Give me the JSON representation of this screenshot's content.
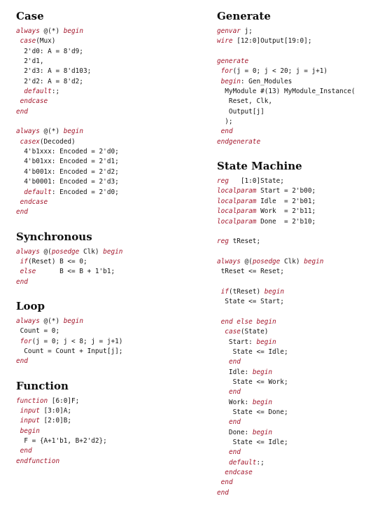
{
  "left_column": [
    {
      "title": "Case",
      "gap_before": 0,
      "lines": [
        [
          {
            "t": "always",
            "k": 1
          },
          {
            "t": " @(*) "
          },
          {
            "t": "begin",
            "k": 1
          }
        ],
        [
          {
            "t": " "
          },
          {
            "t": "case",
            "k": 1
          },
          {
            "t": "(Mux)"
          }
        ],
        [
          {
            "t": "  2'd0: A = 8'd9;"
          }
        ],
        [
          {
            "t": "  2'd1,"
          }
        ],
        [
          {
            "t": "  2'd3: A = 8'd103;"
          }
        ],
        [
          {
            "t": "  2'd2: A = 8'd2;"
          }
        ],
        [
          {
            "t": "  "
          },
          {
            "t": "default",
            "k": 1
          },
          {
            "t": ":;"
          }
        ],
        [
          {
            "t": " "
          },
          {
            "t": "endcase",
            "k": 1
          }
        ],
        [
          {
            "t": "end",
            "k": 1
          }
        ],
        [],
        [
          {
            "t": "always",
            "k": 1
          },
          {
            "t": " @(*) "
          },
          {
            "t": "begin",
            "k": 1
          }
        ],
        [
          {
            "t": " "
          },
          {
            "t": "casex",
            "k": 1
          },
          {
            "t": "(Decoded)"
          }
        ],
        [
          {
            "t": "  4'b1xxx: Encoded = 2'd0;"
          }
        ],
        [
          {
            "t": "  4'b01xx: Encoded = 2'd1;"
          }
        ],
        [
          {
            "t": "  4'b001x: Encoded = 2'd2;"
          }
        ],
        [
          {
            "t": "  4'b0001: Encoded = 2'd3;"
          }
        ],
        [
          {
            "t": "  "
          },
          {
            "t": "default",
            "k": 1
          },
          {
            "t": ": Encoded = 2'd0;"
          }
        ],
        [
          {
            "t": " "
          },
          {
            "t": "endcase",
            "k": 1
          }
        ],
        [
          {
            "t": "end",
            "k": 1
          }
        ]
      ]
    },
    {
      "title": "Synchronous",
      "gap_before": 2,
      "lines": [
        [
          {
            "t": "always",
            "k": 1
          },
          {
            "t": " @("
          },
          {
            "t": "posedge",
            "k": 1
          },
          {
            "t": " Clk) "
          },
          {
            "t": "begin",
            "k": 1
          }
        ],
        [
          {
            "t": " "
          },
          {
            "t": "if",
            "k": 1
          },
          {
            "t": "(Reset) B <= 0;"
          }
        ],
        [
          {
            "t": " "
          },
          {
            "t": "else",
            "k": 1
          },
          {
            "t": "      B <= B + 1'b1;"
          }
        ],
        [
          {
            "t": "end",
            "k": 1
          }
        ]
      ]
    },
    {
      "title": "Loop",
      "gap_before": 2,
      "lines": [
        [
          {
            "t": "always",
            "k": 1
          },
          {
            "t": " @(*) "
          },
          {
            "t": "begin",
            "k": 1
          }
        ],
        [
          {
            "t": " Count = 0;"
          }
        ],
        [
          {
            "t": " "
          },
          {
            "t": "for",
            "k": 1
          },
          {
            "t": "(j = 0; j < 8; j = j+1)"
          }
        ],
        [
          {
            "t": "  Count = Count + Input[j];"
          }
        ],
        [
          {
            "t": "end",
            "k": 1
          }
        ]
      ]
    },
    {
      "title": "Function",
      "gap_before": 2,
      "lines": [
        [
          {
            "t": "function",
            "k": 1
          },
          {
            "t": " [6:0]F;"
          }
        ],
        [
          {
            "t": " "
          },
          {
            "t": "input",
            "k": 1
          },
          {
            "t": " [3:0]A;"
          }
        ],
        [
          {
            "t": " "
          },
          {
            "t": "input",
            "k": 1
          },
          {
            "t": " [2:0]B;"
          }
        ],
        [
          {
            "t": " "
          },
          {
            "t": "begin",
            "k": 1
          }
        ],
        [
          {
            "t": "  F = {A+1'b1, B+2'd2};"
          }
        ],
        [
          {
            "t": " "
          },
          {
            "t": "end",
            "k": 1
          }
        ],
        [
          {
            "t": "endfunction",
            "k": 1
          }
        ]
      ]
    }
  ],
  "right_column": [
    {
      "title": "Generate",
      "gap_before": 0,
      "lines": [
        [
          {
            "t": "genvar",
            "k": 1
          },
          {
            "t": " j;"
          }
        ],
        [
          {
            "t": "wire",
            "k": 1
          },
          {
            "t": " [12:0]Output[19:0];"
          }
        ],
        [],
        [
          {
            "t": "generate",
            "k": 1
          }
        ],
        [
          {
            "t": " "
          },
          {
            "t": "for",
            "k": 1
          },
          {
            "t": "(j = 0; j < 20; j = j+1)"
          }
        ],
        [
          {
            "t": " "
          },
          {
            "t": "begin",
            "k": 1
          },
          {
            "t": ": Gen_Modules"
          }
        ],
        [
          {
            "t": "  MyModule #(13) MyModule_Instance("
          }
        ],
        [
          {
            "t": "   Reset, Clk,"
          }
        ],
        [
          {
            "t": "   Output[j]"
          }
        ],
        [
          {
            "t": "  );"
          }
        ],
        [
          {
            "t": " "
          },
          {
            "t": "end",
            "k": 1
          }
        ],
        [
          {
            "t": "endgenerate",
            "k": 1
          }
        ]
      ]
    },
    {
      "title": "State Machine",
      "gap_before": 2,
      "lines": [
        [
          {
            "t": "reg",
            "k": 1
          },
          {
            "t": "   [1:0]State;"
          }
        ],
        [
          {
            "t": "localparam",
            "k": 1
          },
          {
            "t": " Start = 2'b00;"
          }
        ],
        [
          {
            "t": "localparam",
            "k": 1
          },
          {
            "t": " Idle  = 2'b01;"
          }
        ],
        [
          {
            "t": "localparam",
            "k": 1
          },
          {
            "t": " Work  = 2'b11;"
          }
        ],
        [
          {
            "t": "localparam",
            "k": 1
          },
          {
            "t": " Done  = 2'b10;"
          }
        ],
        [],
        [
          {
            "t": "reg",
            "k": 1
          },
          {
            "t": " tReset;"
          }
        ],
        [],
        [
          {
            "t": "always",
            "k": 1
          },
          {
            "t": " @("
          },
          {
            "t": "posedge",
            "k": 1
          },
          {
            "t": " Clk) "
          },
          {
            "t": "begin",
            "k": 1
          }
        ],
        [
          {
            "t": " tReset <= Reset;"
          }
        ],
        [],
        [
          {
            "t": " "
          },
          {
            "t": "if",
            "k": 1
          },
          {
            "t": "(tReset) "
          },
          {
            "t": "begin",
            "k": 1
          }
        ],
        [
          {
            "t": "  State <= Start;"
          }
        ],
        [],
        [
          {
            "t": " "
          },
          {
            "t": "end",
            "k": 1
          },
          {
            "t": " "
          },
          {
            "t": "else",
            "k": 1
          },
          {
            "t": " "
          },
          {
            "t": "begin",
            "k": 1
          }
        ],
        [
          {
            "t": "  "
          },
          {
            "t": "case",
            "k": 1
          },
          {
            "t": "(State)"
          }
        ],
        [
          {
            "t": "   Start: "
          },
          {
            "t": "begin",
            "k": 1
          }
        ],
        [
          {
            "t": "    State <= Idle;"
          }
        ],
        [
          {
            "t": "   "
          },
          {
            "t": "end",
            "k": 1
          }
        ],
        [
          {
            "t": "   Idle: "
          },
          {
            "t": "begin",
            "k": 1
          }
        ],
        [
          {
            "t": "    State <= Work;"
          }
        ],
        [
          {
            "t": "   "
          },
          {
            "t": "end",
            "k": 1
          }
        ],
        [
          {
            "t": "   Work: "
          },
          {
            "t": "begin",
            "k": 1
          }
        ],
        [
          {
            "t": "    State <= Done;"
          }
        ],
        [
          {
            "t": "   "
          },
          {
            "t": "end",
            "k": 1
          }
        ],
        [
          {
            "t": "   Done: "
          },
          {
            "t": "begin",
            "k": 1
          }
        ],
        [
          {
            "t": "    State <= Idle;"
          }
        ],
        [
          {
            "t": "   "
          },
          {
            "t": "end",
            "k": 1
          }
        ],
        [
          {
            "t": "   "
          },
          {
            "t": "default",
            "k": 1
          },
          {
            "t": ":;"
          }
        ],
        [
          {
            "t": "  "
          },
          {
            "t": "endcase",
            "k": 1
          }
        ],
        [
          {
            "t": " "
          },
          {
            "t": "end",
            "k": 1
          }
        ],
        [
          {
            "t": "end",
            "k": 1
          }
        ]
      ]
    }
  ]
}
